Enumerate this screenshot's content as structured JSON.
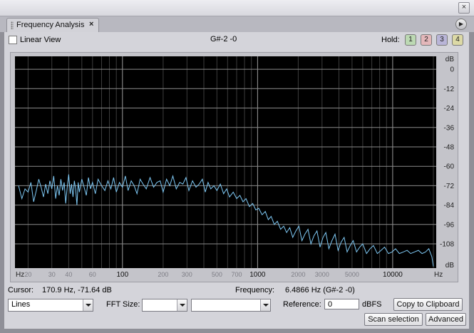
{
  "window": {
    "close_glyph": "×"
  },
  "tab": {
    "title": "Frequency Analysis",
    "close_glyph": "×",
    "menu_glyph": "▶"
  },
  "top_bar": {
    "linear_view_label": "Linear View",
    "linear_view_checked": false,
    "note_readout": "G#-2 -0",
    "hold_label": "Hold:",
    "hold_buttons": [
      {
        "label": "1",
        "color": "#bcd9b3"
      },
      {
        "label": "2",
        "color": "#e3b7ba"
      },
      {
        "label": "3",
        "color": "#b9b5d8"
      },
      {
        "label": "4",
        "color": "#dcd9a6"
      }
    ]
  },
  "status": {
    "cursor_label": "Cursor:",
    "cursor_value": "170.9 Hz, -71.64 dB",
    "frequency_label": "Frequency:",
    "frequency_value": "6.4866 Hz (G#-2 -0)"
  },
  "controls": {
    "style_value": "Lines",
    "fft_label": "FFT Size:",
    "fft_value": "",
    "window_value": "",
    "reference_label": "Reference:",
    "reference_value": "0",
    "reference_unit": "dBFS",
    "copy_button": "Copy to Clipboard",
    "scan_button": "Scan selection",
    "advanced_button": "Advanced"
  },
  "chart_data": {
    "type": "line",
    "x_scale": "log",
    "xlim": [
      16,
      21000
    ],
    "ylim": [
      -123,
      8
    ],
    "grid": true,
    "background": "#000000",
    "grid_color": "#3c3c3c",
    "line_color": "#7ec8f4",
    "x_unit_label": "Hz",
    "x_major_ticks": [
      {
        "value": 100,
        "label": "100"
      },
      {
        "value": 1000,
        "label": "1000"
      },
      {
        "value": 10000,
        "label": "10000"
      }
    ],
    "x_minor_ticks": [
      {
        "value": 20,
        "label": "20"
      },
      {
        "value": 30,
        "label": "30"
      },
      {
        "value": 40,
        "label": "40"
      },
      {
        "value": 60,
        "label": "60"
      },
      {
        "value": 200,
        "label": "200"
      },
      {
        "value": 300,
        "label": "300"
      },
      {
        "value": 500,
        "label": "500"
      },
      {
        "value": 700,
        "label": "700"
      },
      {
        "value": 2000,
        "label": "2000"
      },
      {
        "value": 3000,
        "label": "3000"
      },
      {
        "value": 5000,
        "label": "5000"
      }
    ],
    "y_unit_label": "dB",
    "y_ticks": [
      0,
      -12,
      -24,
      -36,
      -48,
      -60,
      -72,
      -84,
      -96,
      -108
    ],
    "series": [
      {
        "x": [
          17,
          18,
          19,
          20,
          21,
          22,
          23,
          24,
          25,
          26,
          27,
          28,
          29,
          30,
          31,
          32,
          33,
          34,
          35,
          36,
          37,
          38,
          39,
          40,
          41,
          42,
          43,
          44,
          45,
          46,
          47,
          48,
          50,
          52,
          54,
          56,
          58,
          60,
          63,
          66,
          70,
          74,
          78,
          82,
          86,
          90,
          95,
          100,
          105,
          110,
          116,
          122,
          128,
          135,
          142,
          150,
          160,
          170,
          180,
          190,
          200,
          212,
          224,
          236,
          250,
          265,
          280,
          295,
          310,
          330,
          350,
          370,
          390,
          410,
          430,
          450,
          475,
          500,
          530,
          560,
          590,
          620,
          660,
          700,
          740,
          780,
          820,
          870,
          920,
          970,
          1020,
          1080,
          1140,
          1200,
          1260,
          1330,
          1400,
          1480,
          1560,
          1640,
          1730,
          1820,
          1920,
          2020,
          2130,
          2240,
          2360,
          2480,
          2610,
          2750,
          2900,
          3050,
          3200,
          3370,
          3550,
          3740,
          3940,
          4150,
          4370,
          4600,
          4850,
          5100,
          5400,
          5700,
          6000,
          6400,
          6800,
          7200,
          7700,
          8200,
          8700,
          9300,
          9900,
          10500,
          11200,
          12000,
          12800,
          13600,
          14500,
          15500,
          16500,
          17500,
          18500,
          19500,
          20000
        ],
        "y": [
          -72,
          -80,
          -74,
          -76,
          -70,
          -82,
          -75,
          -68,
          -73,
          -79,
          -71,
          -77,
          -69,
          -74,
          -66,
          -80,
          -72,
          -78,
          -68,
          -75,
          -70,
          -83,
          -73,
          -65,
          -77,
          -71,
          -79,
          -69,
          -74,
          -84,
          -70,
          -76,
          -68,
          -73,
          -78,
          -67,
          -74,
          -70,
          -77,
          -68,
          -72,
          -75,
          -69,
          -74,
          -67,
          -76,
          -70,
          -73,
          -66,
          -75,
          -69,
          -72,
          -77,
          -68,
          -71,
          -74,
          -67,
          -73,
          -70,
          -69,
          -76,
          -68,
          -72,
          -66,
          -74,
          -70,
          -71,
          -67,
          -75,
          -69,
          -73,
          -71,
          -68,
          -76,
          -70,
          -74,
          -72,
          -75,
          -71,
          -77,
          -74,
          -79,
          -76,
          -80,
          -78,
          -82,
          -80,
          -85,
          -83,
          -87,
          -86,
          -90,
          -88,
          -93,
          -91,
          -96,
          -94,
          -99,
          -97,
          -101,
          -98,
          -104,
          -100,
          -97,
          -106,
          -102,
          -99,
          -108,
          -103,
          -100,
          -110,
          -104,
          -101,
          -111,
          -106,
          -102,
          -112,
          -107,
          -104,
          -113,
          -109,
          -106,
          -113,
          -110,
          -108,
          -114,
          -111,
          -109,
          -114,
          -112,
          -110,
          -114,
          -113,
          -111,
          -114,
          -113,
          -112,
          -114,
          -113,
          -112,
          -114,
          -113,
          -111,
          -116,
          -122
        ]
      }
    ]
  }
}
